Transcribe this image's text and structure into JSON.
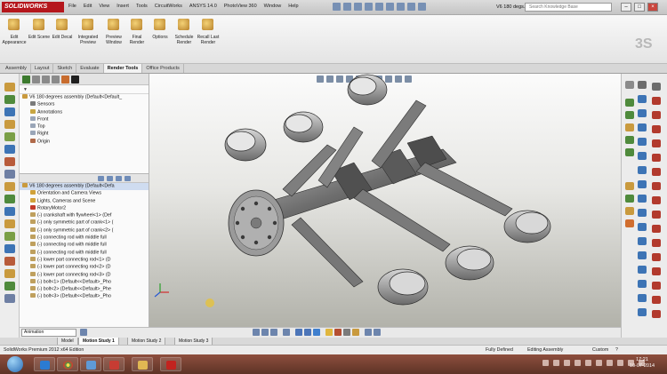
{
  "app": {
    "logo": "SOLIDWORKS",
    "menu": [
      "File",
      "Edit",
      "View",
      "Insert",
      "Tools",
      "CircuitWorks",
      "ANSYS 14.0",
      "PhotoView 360",
      "Window",
      "Help"
    ],
    "doc_title": "V6 180 degs...",
    "search_placeholder": "Search Knowledge Base"
  },
  "command_manager": {
    "tools": [
      {
        "label": "Edit Appearance"
      },
      {
        "label": "Edit Scene"
      },
      {
        "label": "Edit Decal"
      },
      {
        "label": "Integrated Preview"
      },
      {
        "label": "Preview Window"
      },
      {
        "label": "Final Render"
      },
      {
        "label": "Options"
      },
      {
        "label": "Schedule Render"
      },
      {
        "label": "Recall Last Render"
      }
    ],
    "tabs": [
      "Assembly",
      "Layout",
      "Sketch",
      "Evaluate",
      "Render Tools",
      "Office Products"
    ],
    "active_tab": "Render Tools"
  },
  "feature_tree_top": [
    "V6 180 degrees assembly  (Default<Default_",
    "Sensors",
    "Annotations",
    "Front",
    "Top",
    "Right",
    "Origin"
  ],
  "feature_tree_bottom": [
    "V6 180 degrees assembly  (Default<Defa",
    "Orientation and Camera Views",
    "Lights, Cameras and Scene",
    "RotaryMotor2",
    "(-) crankshaft with flywheel<1> (Def",
    "(-) only symmetric part of crank<1> (",
    "(-) only symmetric part of crank<2> (",
    "(-) connecting rod with middle full",
    "(-) connecting rod with middle full",
    "(-) connecting rod with middle full",
    "(-) lower part connecting rod<1> (D",
    "(-) lower part connecting rod<2> (D",
    "(-) lower part connecting rod<3> (D",
    "(-) bolt<1> (Default<<Default>_Pho",
    "(-) bolt<2> (Default<<Default>_Phe",
    "(-) bolt<3> (Default<<Default>_Pho"
  ],
  "motion": {
    "type_value": "Animation",
    "tabs": [
      "Model",
      "Motion Study 1",
      "Motion Study 2",
      "Motion Study 3"
    ],
    "active_tab": "Motion Study 1"
  },
  "status": {
    "edition": "SolidWorks Premium 2012 x64 Edition",
    "state": "Fully Defined",
    "mode": "Editing Assembly",
    "units": "Custom"
  },
  "taskbar": {
    "time": "17:21",
    "date": "10-07-2014"
  }
}
